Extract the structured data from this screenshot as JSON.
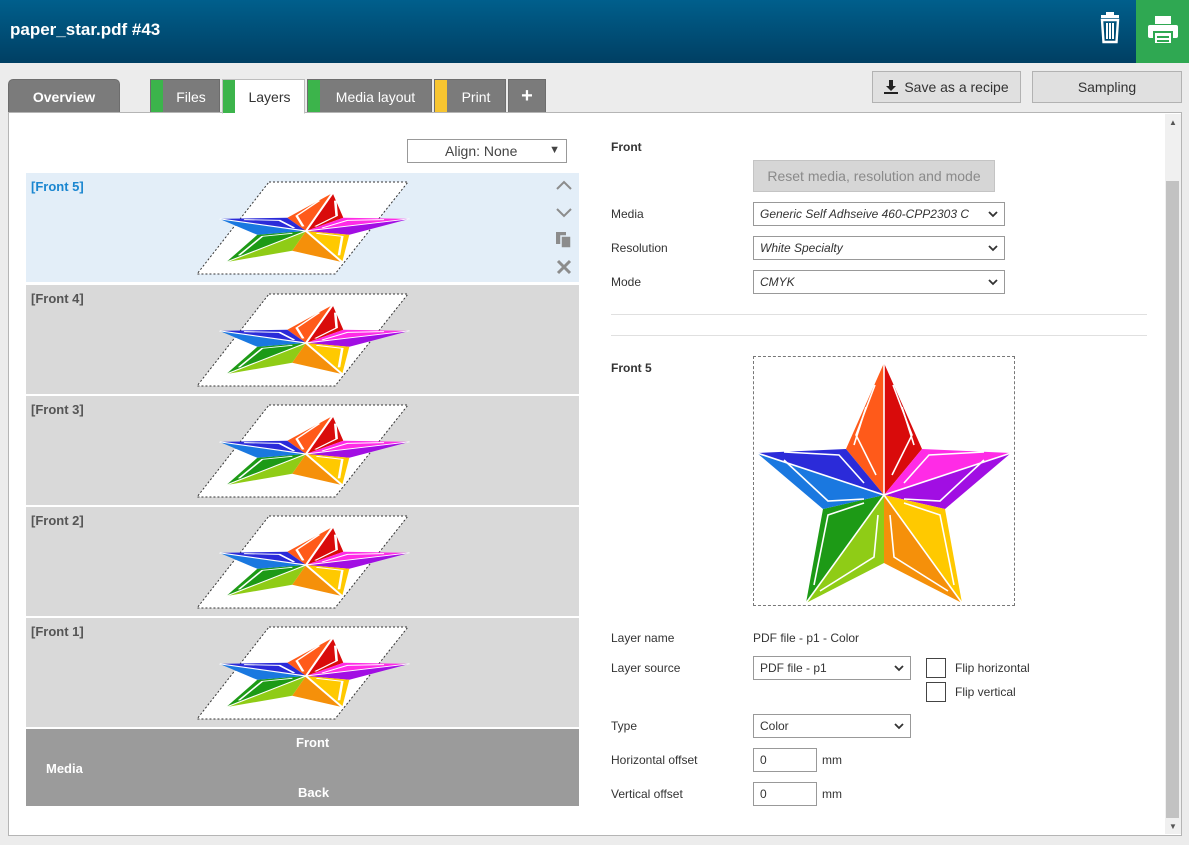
{
  "header": {
    "title": "paper_star.pdf #43"
  },
  "tabs": {
    "overview": "Overview",
    "files": "Files",
    "layers": "Layers",
    "media_layout": "Media layout",
    "print": "Print",
    "add": "+"
  },
  "toolbar": {
    "save_recipe": "Save as a recipe",
    "sampling": "Sampling"
  },
  "left": {
    "align": "Align: None",
    "layers": [
      "[Front 5]",
      "[Front 4]",
      "[Front 3]",
      "[Front 2]",
      "[Front 1]"
    ],
    "media_bar": {
      "front": "Front",
      "media": "Media",
      "back": "Back"
    }
  },
  "right": {
    "section_front": "Front",
    "reset_button": "Reset media, resolution and mode",
    "media_label": "Media",
    "media_value": "Generic Self Adhseive 460-CPP2303 C",
    "resolution_label": "Resolution",
    "resolution_value": "White Specialty",
    "mode_label": "Mode",
    "mode_value": "CMYK",
    "layer_title": "Front 5",
    "layer_name_label": "Layer name",
    "layer_name_value": "PDF file - p1 - Color",
    "layer_source_label": "Layer source",
    "layer_source_value": "PDF file - p1",
    "flip_horizontal": "Flip horizontal",
    "flip_vertical": "Flip vertical",
    "type_label": "Type",
    "type_value": "Color",
    "h_offset_label": "Horizontal offset",
    "h_offset_value": "0",
    "v_offset_label": "Vertical offset",
    "v_offset_value": "0",
    "unit": "mm"
  },
  "colors": {
    "header": "#004f78",
    "print_button": "#2fa852",
    "files_bar": "#3cb44b",
    "layers_bar": "#3cb44b",
    "media_bar_tab": "#3cb44b",
    "print_bar": "#f7c530"
  }
}
